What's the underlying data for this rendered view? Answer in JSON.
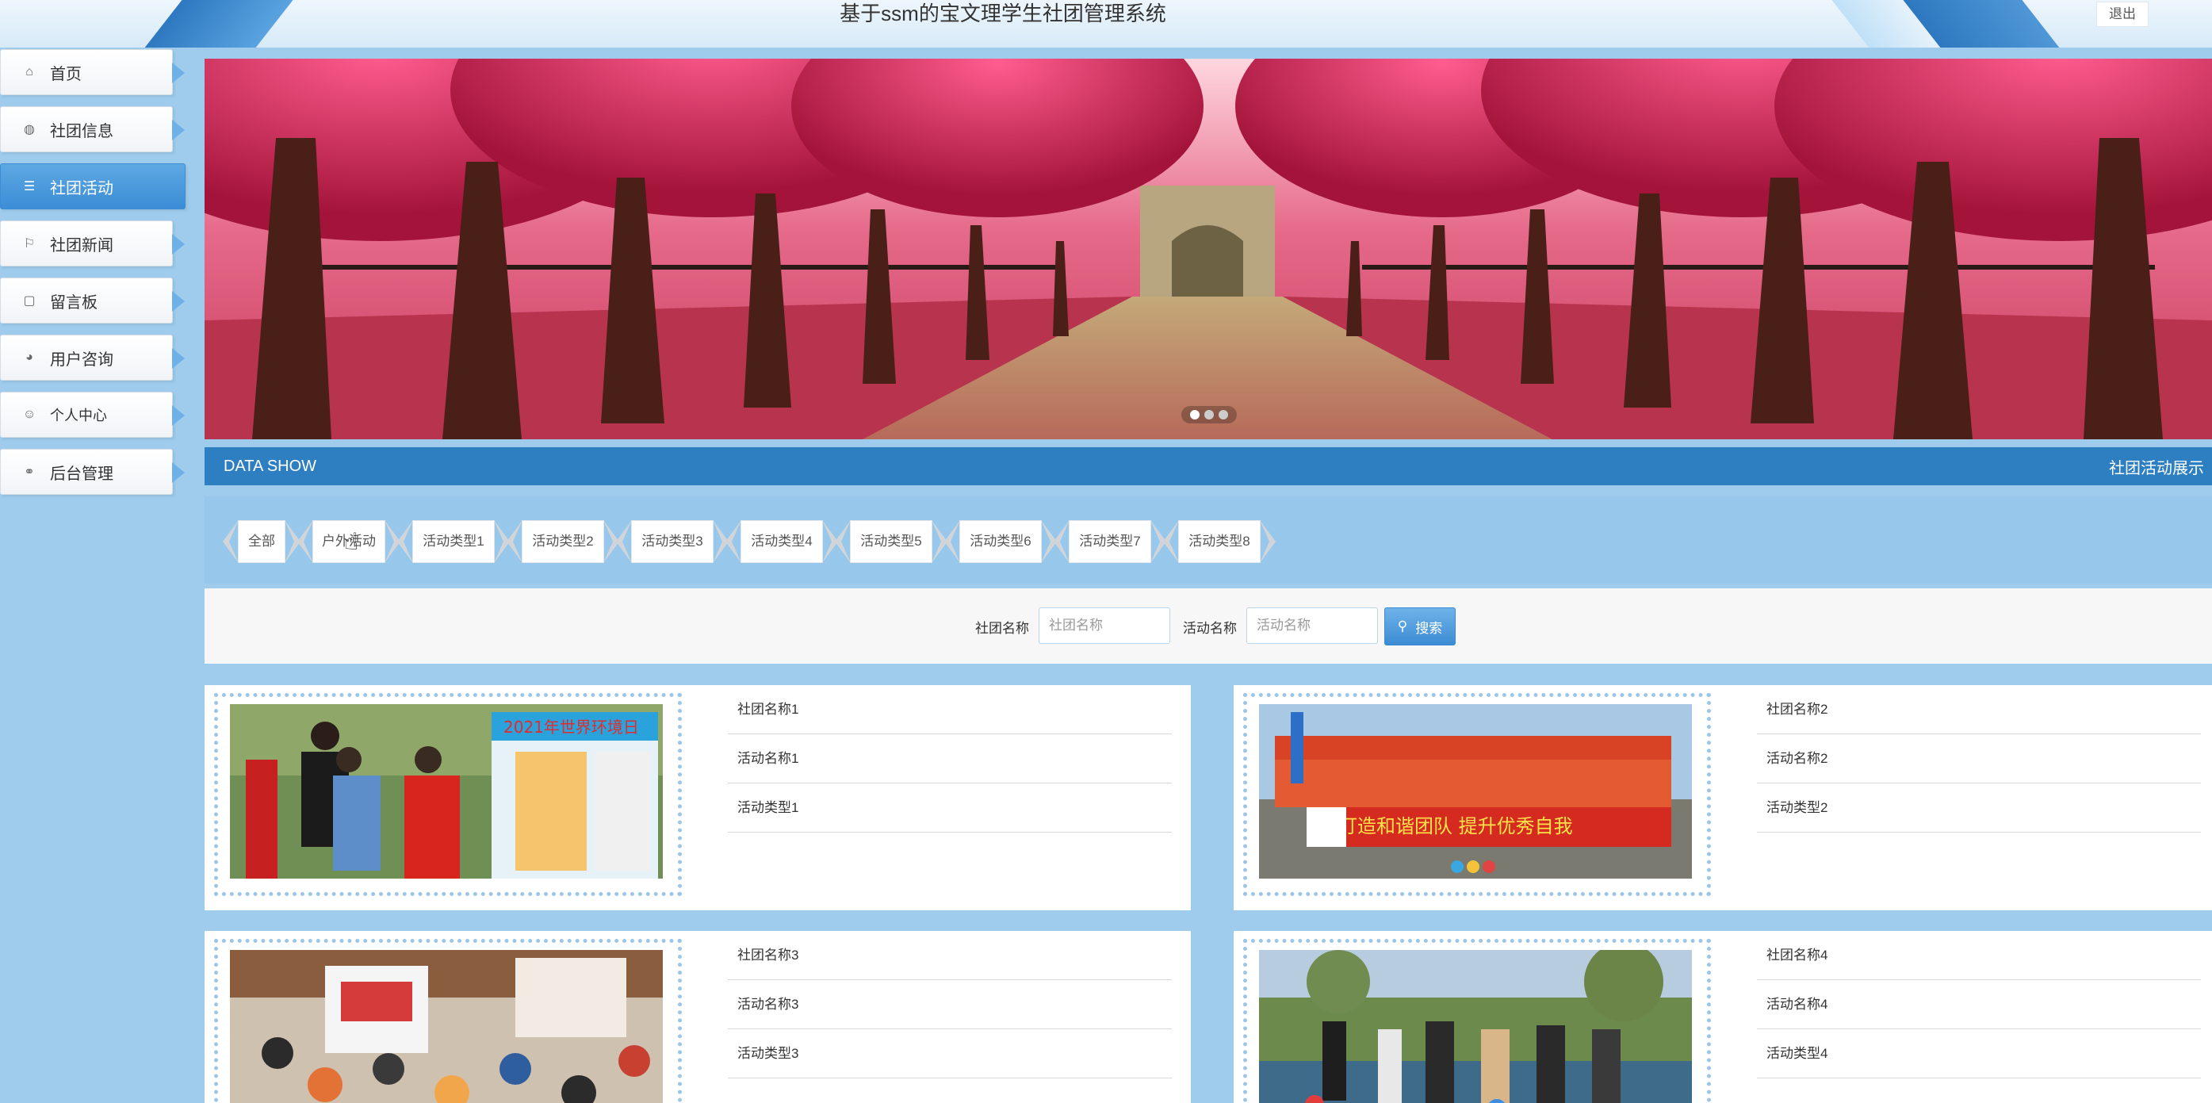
{
  "header": {
    "title": "基于ssm的宝文理学生社团管理系统",
    "logout_label": "退出"
  },
  "sidebar": {
    "items": [
      {
        "label": "首页",
        "icon": "home-icon",
        "active": false
      },
      {
        "label": "社团信息",
        "icon": "globe-icon",
        "active": false
      },
      {
        "label": "社团活动",
        "icon": "list-icon",
        "active": true
      },
      {
        "label": "社团新闻",
        "icon": "flag-icon",
        "active": false
      },
      {
        "label": "留言板",
        "icon": "note-icon",
        "active": false
      },
      {
        "label": "用户咨询",
        "icon": "chat-icon",
        "active": false
      },
      {
        "label": "个人中心",
        "icon": "user-icon",
        "active": false
      },
      {
        "label": "后台管理",
        "icon": "link-icon",
        "active": false
      }
    ]
  },
  "banner": {
    "slides": 3,
    "active_slide": 1
  },
  "section": {
    "left_label": "DATA SHOW",
    "right_label": "社团活动展示"
  },
  "filters": [
    "全部",
    "户外活动",
    "活动类型1",
    "活动类型2",
    "活动类型3",
    "活动类型4",
    "活动类型5",
    "活动类型6",
    "活动类型7",
    "活动类型8"
  ],
  "search": {
    "club_label": "社团名称",
    "club_placeholder": "社团名称",
    "activity_label": "活动名称",
    "activity_placeholder": "活动名称",
    "button_label": "搜索"
  },
  "cards": [
    {
      "club": "社团名称1",
      "activity": "活动名称1",
      "type": "活动类型1",
      "image_banner": "2021年世界环境日"
    },
    {
      "club": "社团名称2",
      "activity": "活动名称2",
      "type": "活动类型2",
      "image_banner": "打造和谐团队 提升优秀自我"
    },
    {
      "club": "社团名称3",
      "activity": "活动名称3",
      "type": "活动类型3"
    },
    {
      "club": "社团名称4",
      "activity": "活动名称4",
      "type": "活动类型4"
    }
  ],
  "colors": {
    "primary": "#2e7fc2",
    "sidebar_bg": "#9fcbec",
    "active_nav": "#3b8dd6"
  }
}
